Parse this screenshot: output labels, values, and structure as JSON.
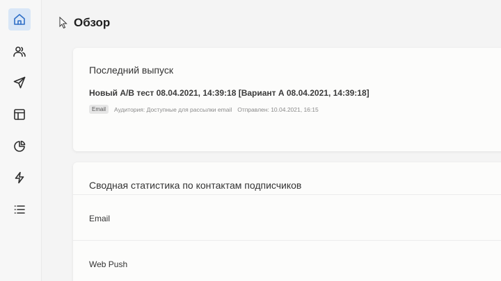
{
  "page": {
    "title": "Обзор"
  },
  "sidebar": {
    "items": [
      {
        "icon": "home-icon",
        "active": true
      },
      {
        "icon": "users-icon",
        "active": false
      },
      {
        "icon": "send-icon",
        "active": false
      },
      {
        "icon": "layout-icon",
        "active": false
      },
      {
        "icon": "pie-chart-icon",
        "active": false
      },
      {
        "icon": "lightning-icon",
        "active": false
      },
      {
        "icon": "list-icon",
        "active": false
      }
    ]
  },
  "last_issue": {
    "title": "Последний выпуск",
    "name": "Новый A/B тест 08.04.2021, 14:39:18 [Вариант А 08.04.2021, 14:39:18]",
    "channel_badge": "Email",
    "audience": "Аудитория: Доступные для рассылки email",
    "sent": "Отправлен: 10.04.2021, 16:15"
  },
  "summary": {
    "title": "Сводная статистика по контактам подписчиков",
    "rows": [
      {
        "label": "Email"
      },
      {
        "label": "Web Push"
      }
    ]
  },
  "colors": {
    "accent": "#2f6fc6",
    "active_bg": "#d9e7f7",
    "background": "#f4f4f4"
  }
}
